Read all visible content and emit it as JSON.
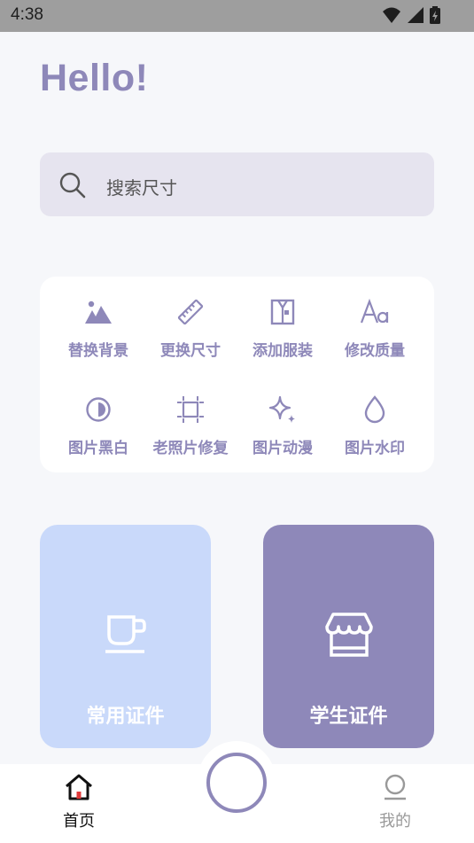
{
  "status_bar": {
    "time": "4:38",
    "icons": [
      "wifi-icon",
      "signal-icon",
      "battery-icon"
    ]
  },
  "greeting": "Hello!",
  "search": {
    "placeholder": "搜索尺寸",
    "icon": "search-icon"
  },
  "tools": [
    {
      "label": "替换背景",
      "icon": "mountain-icon"
    },
    {
      "label": "更换尺寸",
      "icon": "ruler-icon"
    },
    {
      "label": "添加服装",
      "icon": "shirt-icon"
    },
    {
      "label": "修改质量",
      "icon": "font-icon"
    },
    {
      "label": "图片黑白",
      "icon": "contrast-icon"
    },
    {
      "label": "老照片修复",
      "icon": "crop-icon"
    },
    {
      "label": "图片动漫",
      "icon": "sparkle-icon"
    },
    {
      "label": "图片水印",
      "icon": "drop-icon"
    }
  ],
  "cards": [
    {
      "label": "常用证件",
      "icon": "cup-icon",
      "color": "#c9d9fa"
    },
    {
      "label": "学生证件",
      "icon": "store-icon",
      "color": "#8e88b9"
    }
  ],
  "bottom_nav": {
    "home": {
      "label": "首页",
      "icon": "home-icon"
    },
    "center": {
      "icon": "circle-icon"
    },
    "mine": {
      "label": "我的",
      "icon": "user-icon"
    }
  },
  "colors": {
    "accent": "#8e88b9",
    "background": "#f6f7fa",
    "search_bg": "#e6e4ef",
    "card_blue": "#c9d9fa"
  }
}
